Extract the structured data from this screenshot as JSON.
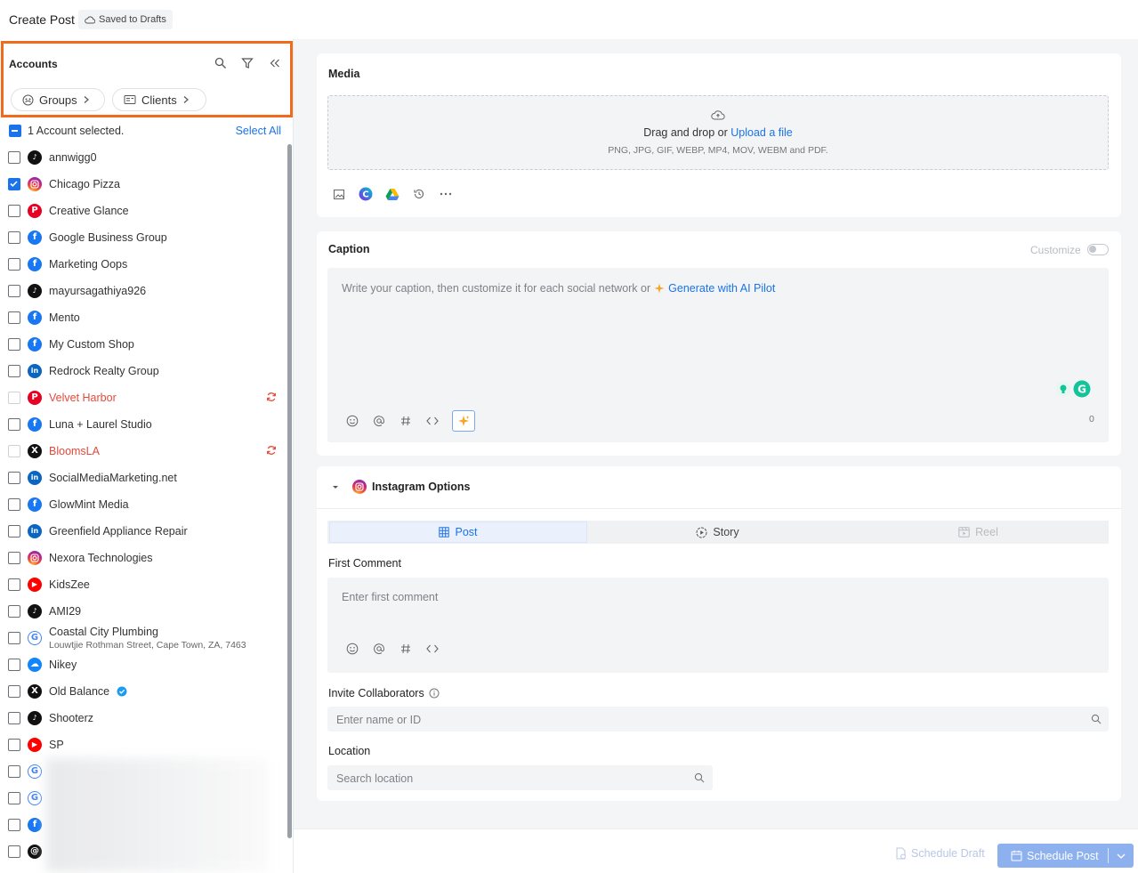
{
  "header": {
    "title": "Create Post",
    "draft_status": "Saved to Drafts"
  },
  "accounts": {
    "title": "Accounts",
    "groups_label": "Groups",
    "clients_label": "Clients",
    "selected_text": "1 Account selected.",
    "select_all": "Select All",
    "items": [
      {
        "name": "annwigg0",
        "network": "tiktok-icon",
        "checked": false
      },
      {
        "name": "Chicago Pizza",
        "network": "instagram-icon",
        "checked": true
      },
      {
        "name": "Creative Glance",
        "network": "pinterest-icon",
        "checked": false
      },
      {
        "name": "Google Business Group",
        "network": "facebook-icon",
        "checked": false
      },
      {
        "name": "Marketing Oops",
        "network": "facebook-icon",
        "checked": false
      },
      {
        "name": "mayursagathiya926",
        "network": "tiktok-icon",
        "checked": false
      },
      {
        "name": "Mento",
        "network": "facebook-icon",
        "checked": false
      },
      {
        "name": "My Custom Shop",
        "network": "facebook-icon",
        "checked": false
      },
      {
        "name": "Redrock Realty Group",
        "network": "linkedin-icon",
        "checked": false
      },
      {
        "name": "Velvet Harbor",
        "network": "pinterest-icon",
        "checked": false,
        "error": true
      },
      {
        "name": "Luna + Laurel Studio",
        "network": "facebook-icon",
        "checked": false
      },
      {
        "name": "BloomsLA",
        "network": "x-icon",
        "checked": false,
        "error": true
      },
      {
        "name": "SocialMediaMarketing.net",
        "network": "linkedin-icon",
        "checked": false
      },
      {
        "name": "GlowMint Media",
        "network": "facebook-icon",
        "checked": false
      },
      {
        "name": "Greenfield Appliance Repair",
        "network": "linkedin-icon",
        "checked": false
      },
      {
        "name": "Nexora Technologies",
        "network": "instagram-icon",
        "checked": false
      },
      {
        "name": "KidsZee",
        "network": "youtube-icon",
        "checked": false
      },
      {
        "name": "AMI29",
        "network": "tiktok-icon",
        "checked": false
      },
      {
        "name": "Coastal City Plumbing",
        "subtitle": "Louwtjie Rothman Street, Cape Town, ZA, 7463",
        "network": "google-icon",
        "checked": false
      },
      {
        "name": "Nikey",
        "network": "bluesky-icon",
        "checked": false
      },
      {
        "name": "Old Balance",
        "network": "x-icon",
        "checked": false,
        "verified": true
      },
      {
        "name": "Shooterz",
        "network": "tiktok-icon",
        "checked": false
      },
      {
        "name": "SP",
        "network": "youtube-icon",
        "checked": false
      },
      {
        "name": "",
        "network": "google-icon",
        "checked": false
      },
      {
        "name": "",
        "network": "google-icon",
        "checked": false
      },
      {
        "name": "",
        "network": "facebook-icon",
        "checked": false
      },
      {
        "name": "",
        "network": "threads-icon",
        "checked": false
      }
    ]
  },
  "media": {
    "title": "Media",
    "drop_text": "Drag and drop or ",
    "upload_link": "Upload a file",
    "formats": "PNG, JPG, GIF, WEBP, MP4, MOV, WEBM and PDF."
  },
  "caption": {
    "title": "Caption",
    "customize_label": "Customize",
    "placeholder": "Write your caption, then customize it for each social network or",
    "ai_link": "Generate with AI Pilot",
    "char_count": "0"
  },
  "instagram": {
    "title": "Instagram Options",
    "tabs": [
      "Post",
      "Story",
      "Reel"
    ],
    "first_comment_label": "First Comment",
    "first_comment_placeholder": "Enter first comment",
    "collaborators_label": "Invite Collaborators",
    "collaborators_placeholder": "Enter name or ID",
    "location_label": "Location",
    "location_placeholder": "Search location"
  },
  "footer": {
    "schedule_draft": "Schedule Draft",
    "schedule_post": "Schedule Post"
  },
  "colors": {
    "accent": "#1a73e8",
    "highlight_border": "#f26b1d",
    "error": "#e5493a",
    "primary_button": "#8db1ee"
  }
}
